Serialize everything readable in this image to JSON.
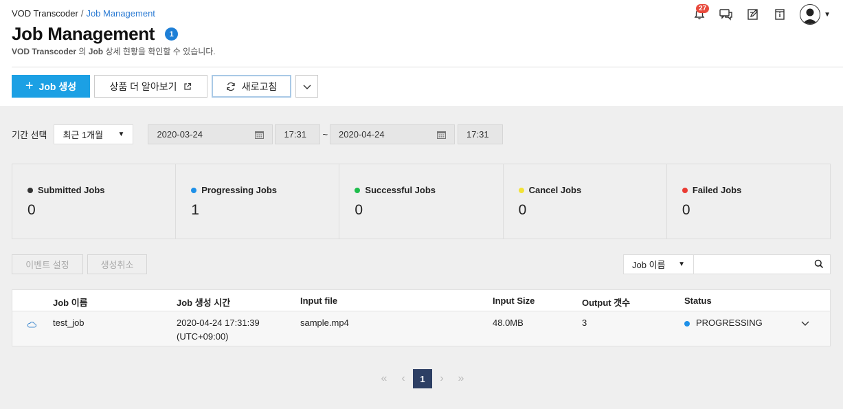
{
  "breadcrumb": {
    "root": "VOD Transcoder",
    "separator": "/",
    "current": "Job Management"
  },
  "page": {
    "title": "Job Management",
    "count_badge": "1",
    "subtitle_brand": "VOD Transcoder",
    "subtitle_mid": "의",
    "subtitle_job": "Job",
    "subtitle_rest": "상세 현황을 확인할 수 있습니다."
  },
  "header": {
    "notification_count": "27"
  },
  "toolbar": {
    "create_plus": "+",
    "create_label": "Job 생성",
    "learn_more_label": "상품 더 알아보기",
    "refresh_label": "새로고침"
  },
  "filter": {
    "period_label": "기간 선택",
    "period_value": "최근 1개월",
    "start_date": "2020-03-24",
    "start_time": "17:31",
    "tilde": "~",
    "end_date": "2020-04-24",
    "end_time": "17:31"
  },
  "stats": [
    {
      "label": "Submitted Jobs",
      "value": "0",
      "color": "#333333"
    },
    {
      "label": "Progressing Jobs",
      "value": "1",
      "color": "#1e90e8"
    },
    {
      "label": "Successful Jobs",
      "value": "0",
      "color": "#1ebd4c"
    },
    {
      "label": "Cancel Jobs",
      "value": "0",
      "color": "#f2e236"
    },
    {
      "label": "Failed Jobs",
      "value": "0",
      "color": "#ea3b33"
    }
  ],
  "actions": {
    "event_settings": "이벤트 설정",
    "cancel_creation": "생성취소"
  },
  "search": {
    "field": "Job 이름",
    "placeholder": ""
  },
  "table": {
    "headers": [
      "Job 이름",
      "Job 생성 시간",
      "Input file",
      "Input Size",
      "Output 갯수",
      "Status"
    ],
    "rows": [
      {
        "name": "test_job",
        "created_date": "2020-04-24 17:31:39",
        "created_tz": "(UTC+09:00)",
        "input_file": "sample.mp4",
        "input_size": "48.0MB",
        "output_count": "3",
        "status": "PROGRESSING",
        "status_color": "#1e90e8"
      }
    ]
  },
  "pagination": {
    "current": "1"
  }
}
